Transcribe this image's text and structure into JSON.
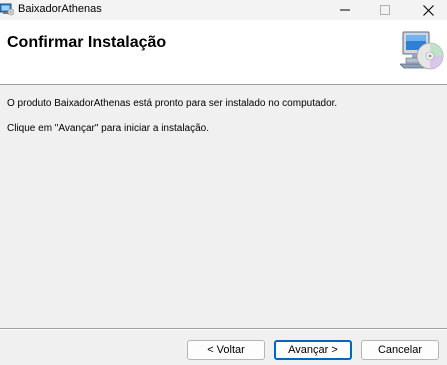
{
  "window": {
    "title": "BaixadorAthenas"
  },
  "header": {
    "title": "Confirmar Instalação"
  },
  "body": {
    "line1": "O produto BaixadorAthenas está pronto para ser instalado no computador.",
    "line2": "Clique em \"Avançar\" para iniciar a instalação."
  },
  "buttons": {
    "back": "< Voltar",
    "next": "Avançar >",
    "cancel": "Cancelar"
  },
  "icons": {
    "app": "installer-app-icon",
    "header": "computer-disc-icon",
    "minimize": "minimize-icon",
    "maximize": "maximize-icon",
    "close": "close-icon"
  },
  "colors": {
    "accent": "#0067c0",
    "titlebar": "#f3f3f3",
    "body": "#f0f0f0",
    "header": "#ffffff"
  }
}
